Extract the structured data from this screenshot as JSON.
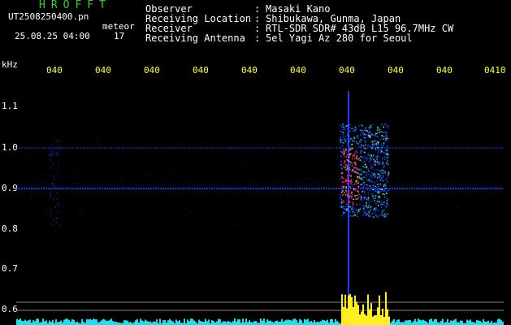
{
  "app": {
    "title": "HROFFT"
  },
  "file": {
    "name": "UT2508250400.pn",
    "label": "meteor"
  },
  "timestamp": "25.08.25 04:00",
  "meteor_count": "17",
  "meta": [
    {
      "key": "Observer",
      "sep": ":",
      "value": "Masaki Kano"
    },
    {
      "key": "Receiving Location",
      "sep": ":",
      "value": "Shibukawa, Gunma, Japan"
    },
    {
      "key": "Receiver",
      "sep": ":",
      "value": "RTL-SDR SDR# 43dB L15 96.7MHz CW"
    },
    {
      "key": "Receiving Antenna",
      "sep": ":",
      "value": "5el Yagi Az 280 for Seoul"
    }
  ],
  "chart_data": {
    "type": "heatmap",
    "ylabel": "kHz",
    "x_ticks": [
      "040",
      "040",
      "040",
      "040",
      "040",
      "040",
      "040",
      "040",
      "040",
      "0410"
    ],
    "y_ticks": [
      "1.1",
      "1.0",
      "0.9",
      "0.8",
      "0.7",
      "0.6"
    ],
    "y_values": [
      1.1,
      1.0,
      0.9,
      0.8,
      0.7,
      0.6
    ],
    "ylim": [
      0.58,
      1.17
    ],
    "xlim": [
      0,
      10
    ],
    "reference_lines_khz": [
      1.0,
      0.9
    ],
    "threshold_lines": [
      0.62,
      0.6
    ],
    "colors": {
      "background": "#000000",
      "trace": "#1a3cff",
      "intense": "#ff1a8c",
      "mid": "#22ddaa",
      "hot": "#ffee22",
      "tick_x": "#ffff33",
      "app_title": "#2bd42b"
    }
  }
}
